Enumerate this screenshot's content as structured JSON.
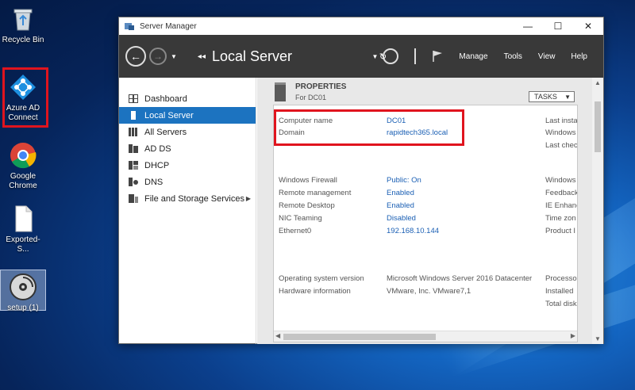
{
  "desktop": {
    "icons": [
      {
        "label": "Recycle Bin",
        "icon": "recycle-bin-icon"
      },
      {
        "label": "Azure AD Connect",
        "icon": "azure-ad-connect-icon"
      },
      {
        "label": "Google Chrome",
        "icon": "chrome-icon"
      },
      {
        "label": "Exported-S...",
        "icon": "file-icon"
      },
      {
        "label": "setup (1)",
        "icon": "disc-icon"
      }
    ]
  },
  "window": {
    "title": "Server Manager",
    "breadcrumb": "Local Server",
    "menu": [
      "Manage",
      "Tools",
      "View",
      "Help"
    ],
    "controls": {
      "minimize": "—",
      "maximize": "☐",
      "close": "✕"
    }
  },
  "sidebar": {
    "items": [
      {
        "label": "Dashboard",
        "icon": "dashboard-icon"
      },
      {
        "label": "Local Server",
        "icon": "server-icon",
        "active": true
      },
      {
        "label": "All Servers",
        "icon": "servers-icon"
      },
      {
        "label": "AD DS",
        "icon": "ad-ds-icon"
      },
      {
        "label": "DHCP",
        "icon": "dhcp-icon"
      },
      {
        "label": "DNS",
        "icon": "dns-icon"
      },
      {
        "label": "File and Storage Services",
        "icon": "storage-icon"
      }
    ]
  },
  "properties": {
    "title": "PROPERTIES",
    "subtitle": "For DC01",
    "tasks_label": "TASKS",
    "group1": [
      {
        "label": "Computer name",
        "value": "DC01"
      },
      {
        "label": "Domain",
        "value": "rapidtech365.local"
      }
    ],
    "group2": [
      {
        "label": "Windows Firewall",
        "value": "Public: On"
      },
      {
        "label": "Remote management",
        "value": "Enabled"
      },
      {
        "label": "Remote Desktop",
        "value": "Enabled"
      },
      {
        "label": "NIC Teaming",
        "value": "Disabled"
      },
      {
        "label": "Ethernet0",
        "value": "192.168.10.144"
      }
    ],
    "group3": [
      {
        "label": "Operating system version",
        "value": "Microsoft Windows Server 2016 Datacenter"
      },
      {
        "label": "Hardware information",
        "value": "VMware, Inc. VMware7,1"
      }
    ],
    "right_column": [
      "Last insta",
      "Windows",
      "Last chec",
      "Windows",
      "Feedback",
      "IE Enhanc",
      "Time zon",
      "Product I",
      "Processo",
      "Installed",
      "Total disk"
    ]
  },
  "colors": {
    "accent": "#1c73c0",
    "highlight": "#e0141e",
    "toolbar": "#393939"
  }
}
